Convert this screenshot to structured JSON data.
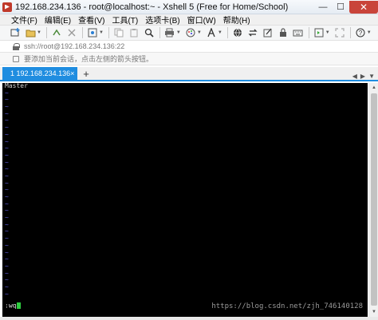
{
  "window": {
    "title": "192.168.234.136 - root@localhost:~ - Xshell 5 (Free for Home/School)",
    "minimize": "—",
    "maximize": "☐",
    "close": "✕"
  },
  "menu": {
    "items": [
      {
        "label": "文件(F)"
      },
      {
        "label": "编辑(E)"
      },
      {
        "label": "查看(V)"
      },
      {
        "label": "工具(T)"
      },
      {
        "label": "选项卡(B)"
      },
      {
        "label": "窗口(W)"
      },
      {
        "label": "帮助(H)"
      }
    ]
  },
  "toolbar": {
    "icons": [
      "new-session-icon",
      "open-folder-icon",
      "reconnect-icon",
      "disconnect-icon",
      "properties-icon",
      "copy-icon",
      "paste-icon",
      "find-icon",
      "print-icon",
      "color-scheme-icon",
      "font-icon",
      "globe-icon",
      "transfer-icon",
      "compose-icon",
      "lock-icon",
      "keyboard-icon",
      "script-icon",
      "fullscreen-icon",
      "help-icon"
    ]
  },
  "address": {
    "text": "ssh://root@192.168.234.136:22"
  },
  "hint": {
    "text": "要添加当前会话，点击左侧的箭头按钮。"
  },
  "tabs": [
    {
      "number": "1",
      "label": "192.168.234.136",
      "active": true
    }
  ],
  "tab_bar": {
    "add": "+",
    "close": "×",
    "prev": "◀",
    "next": "▶",
    "menu": "▼"
  },
  "terminal": {
    "first_line": "Master",
    "tilde": "~",
    "tilde_count": 30,
    "command": ":wq",
    "watermark": "https://blog.csdn.net/zjh_746140128"
  },
  "colors": {
    "accent": "#1f8de0",
    "terminal_bg": "#000000",
    "tilde": "#5b5bd8",
    "cursor": "#2ecc40",
    "close_button": "#c9443a"
  }
}
